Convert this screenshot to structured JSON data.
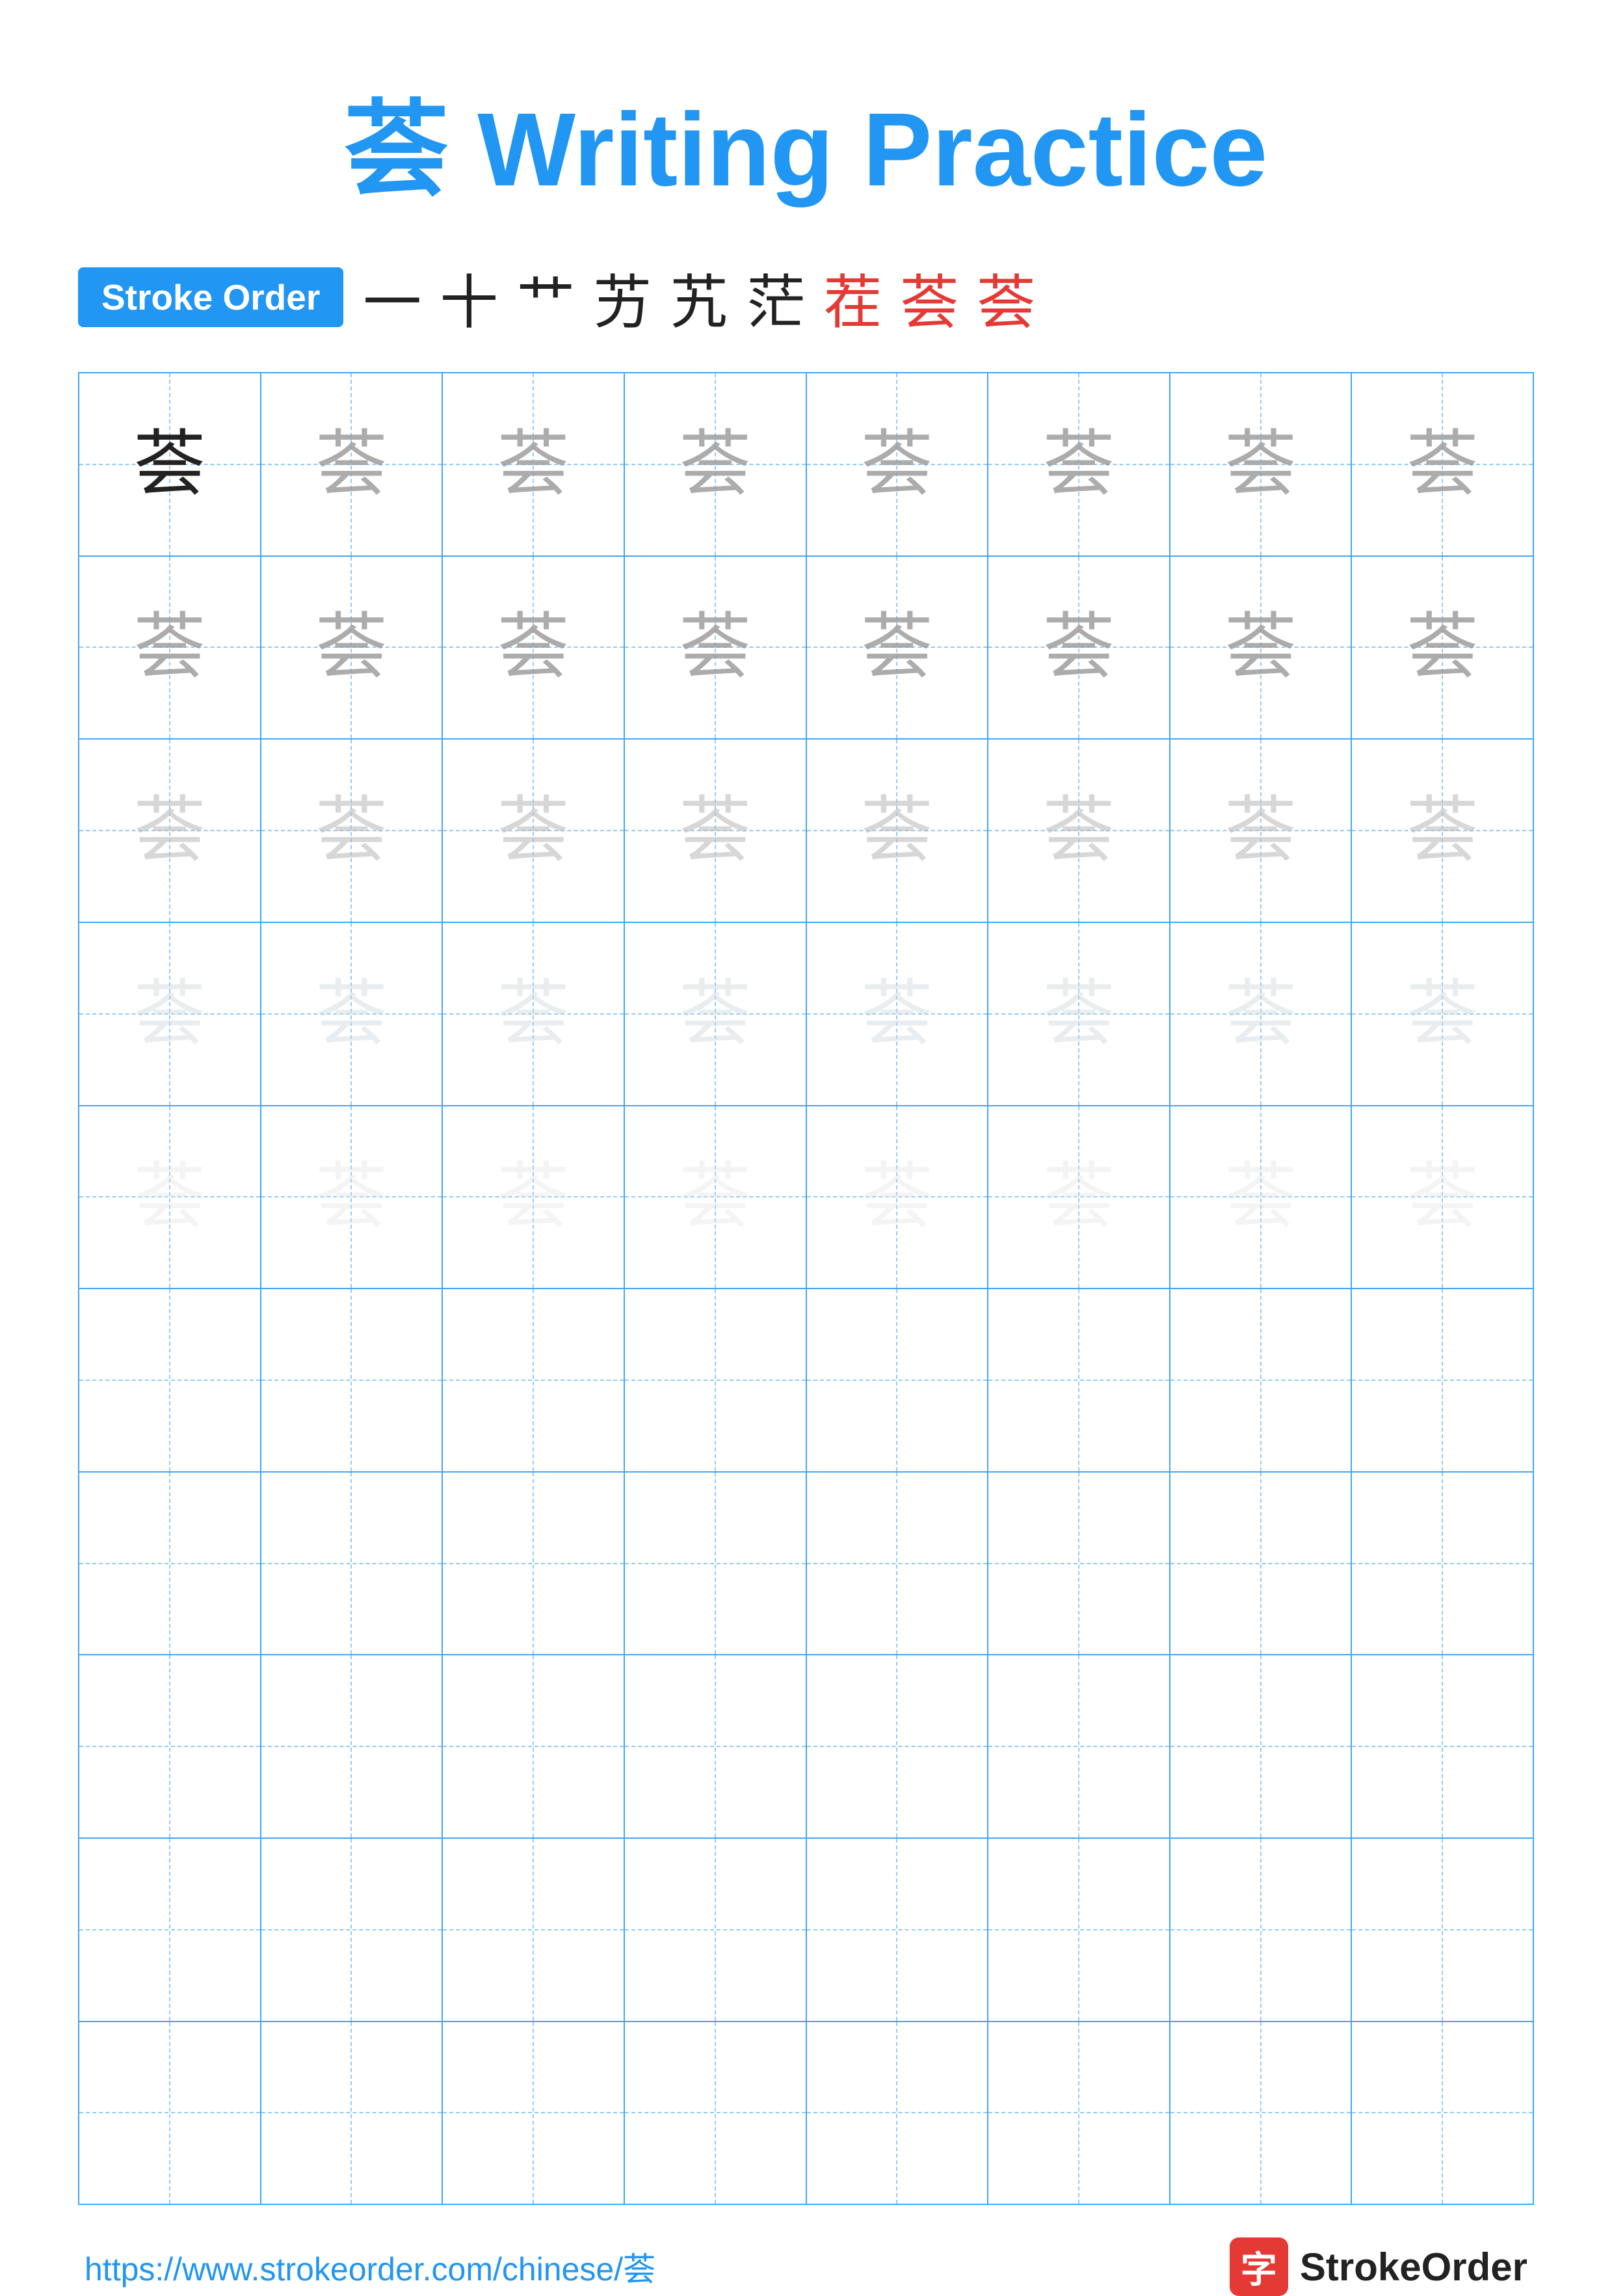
{
  "title": {
    "char": "荟",
    "text": " Writing Practice"
  },
  "stroke_order": {
    "badge_label": "Stroke Order",
    "strokes": [
      "一",
      "十",
      "艹",
      "艻",
      "艽",
      "茫",
      "茬",
      "荟",
      "荟"
    ]
  },
  "grid": {
    "rows": 10,
    "cols": 8,
    "char": "荟",
    "practice_rows": [
      [
        {
          "char": "荟",
          "style": "char-dark"
        },
        {
          "char": "荟",
          "style": "char-medium"
        },
        {
          "char": "荟",
          "style": "char-medium"
        },
        {
          "char": "荟",
          "style": "char-medium"
        },
        {
          "char": "荟",
          "style": "char-medium"
        },
        {
          "char": "荟",
          "style": "char-medium"
        },
        {
          "char": "荟",
          "style": "char-medium"
        },
        {
          "char": "荟",
          "style": "char-medium"
        }
      ],
      [
        {
          "char": "荟",
          "style": "char-medium"
        },
        {
          "char": "荟",
          "style": "char-medium"
        },
        {
          "char": "荟",
          "style": "char-medium"
        },
        {
          "char": "荟",
          "style": "char-medium"
        },
        {
          "char": "荟",
          "style": "char-medium"
        },
        {
          "char": "荟",
          "style": "char-medium"
        },
        {
          "char": "荟",
          "style": "char-medium"
        },
        {
          "char": "荟",
          "style": "char-medium"
        }
      ],
      [
        {
          "char": "荟",
          "style": "char-light"
        },
        {
          "char": "荟",
          "style": "char-light"
        },
        {
          "char": "荟",
          "style": "char-light"
        },
        {
          "char": "荟",
          "style": "char-light"
        },
        {
          "char": "荟",
          "style": "char-light"
        },
        {
          "char": "荟",
          "style": "char-light"
        },
        {
          "char": "荟",
          "style": "char-light"
        },
        {
          "char": "荟",
          "style": "char-light"
        }
      ],
      [
        {
          "char": "荟",
          "style": "char-vlight"
        },
        {
          "char": "荟",
          "style": "char-vlight"
        },
        {
          "char": "荟",
          "style": "char-vlight"
        },
        {
          "char": "荟",
          "style": "char-vlight"
        },
        {
          "char": "荟",
          "style": "char-vlight"
        },
        {
          "char": "荟",
          "style": "char-vlight"
        },
        {
          "char": "荟",
          "style": "char-vlight"
        },
        {
          "char": "荟",
          "style": "char-vlight"
        }
      ],
      [
        {
          "char": "荟",
          "style": "char-faint"
        },
        {
          "char": "荟",
          "style": "char-faint"
        },
        {
          "char": "荟",
          "style": "char-faint"
        },
        {
          "char": "荟",
          "style": "char-faint"
        },
        {
          "char": "荟",
          "style": "char-faint"
        },
        {
          "char": "荟",
          "style": "char-faint"
        },
        {
          "char": "荟",
          "style": "char-faint"
        },
        {
          "char": "荟",
          "style": "char-faint"
        }
      ]
    ]
  },
  "footer": {
    "url": "https://www.strokeorder.com/chinese/荟",
    "logo_icon": "字",
    "logo_text": "StrokeOrder"
  }
}
